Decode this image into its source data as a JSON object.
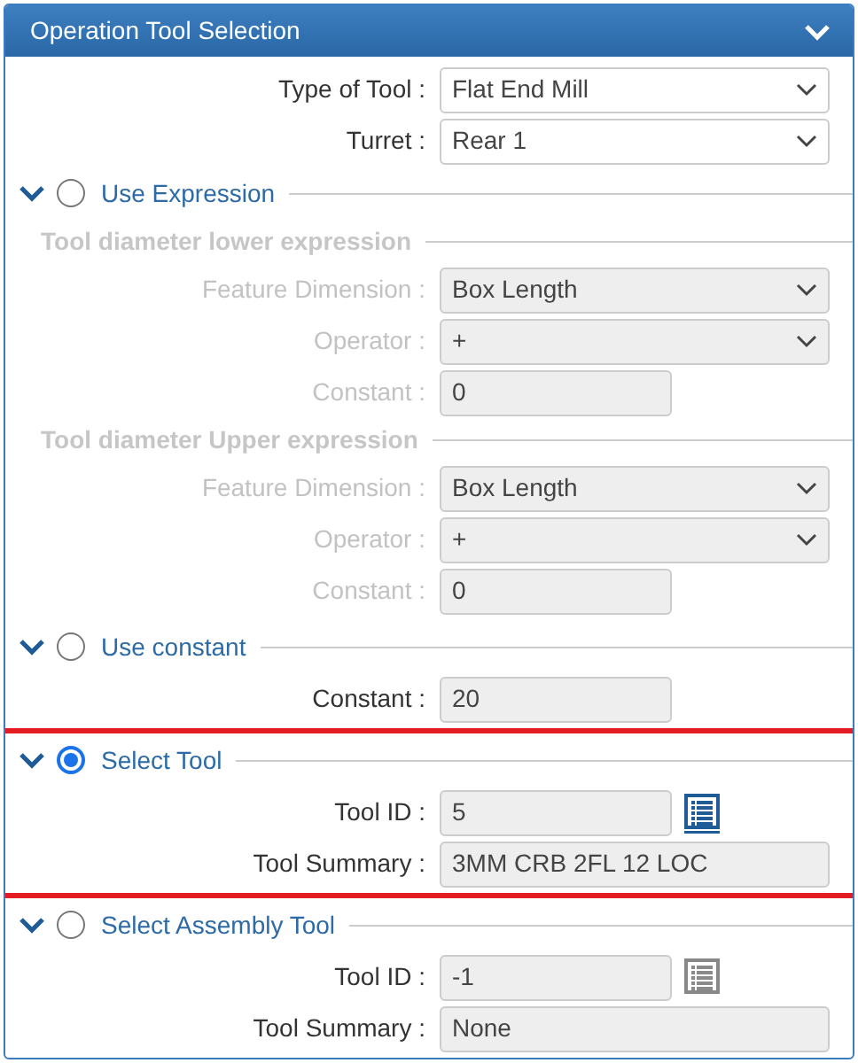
{
  "panel": {
    "title": "Operation Tool Selection",
    "expanded": true
  },
  "fields": [
    {
      "label": "Type of Tool :",
      "kind": "select",
      "value": "Flat End Mill",
      "disabled": false,
      "readonly": false
    },
    {
      "label": "Turret :",
      "kind": "select",
      "value": "Rear 1",
      "disabled": false,
      "readonly": false
    }
  ],
  "sections": [
    {
      "label": "Use Expression",
      "selected": false,
      "expanded": true,
      "highlighted": false,
      "groups": [
        {
          "heading": "Tool diameter lower expression",
          "fields": [
            {
              "label": "Feature Dimension :",
              "kind": "select",
              "value": "Box Length",
              "disabled": true
            },
            {
              "label": "Operator :",
              "kind": "select",
              "value": "+",
              "disabled": true
            },
            {
              "label": "Constant :",
              "kind": "text",
              "value": "0",
              "disabled": true
            }
          ]
        },
        {
          "heading": "Tool diameter Upper expression",
          "fields": [
            {
              "label": "Feature Dimension :",
              "kind": "select",
              "value": "Box Length",
              "disabled": true
            },
            {
              "label": "Operator :",
              "kind": "select",
              "value": "+",
              "disabled": true
            },
            {
              "label": "Constant :",
              "kind": "text",
              "value": "0",
              "disabled": true
            }
          ]
        }
      ]
    },
    {
      "label": "Use constant",
      "selected": false,
      "expanded": true,
      "highlighted": false,
      "groups": [
        {
          "fields": [
            {
              "label": "Constant :",
              "kind": "text",
              "value": "20",
              "disabled": false,
              "readonly": true
            }
          ]
        }
      ]
    },
    {
      "label": "Select Tool",
      "selected": true,
      "expanded": true,
      "highlighted": true,
      "groups": [
        {
          "fields": [
            {
              "label": "Tool ID :",
              "kind": "text",
              "value": "5",
              "disabled": false,
              "readonly": true,
              "picker": {
                "enabled": true
              }
            },
            {
              "label": "Tool Summary :",
              "kind": "wide",
              "value": "3MM CRB 2FL 12 LOC",
              "disabled": false,
              "readonly": true
            }
          ]
        }
      ]
    },
    {
      "label": "Select Assembly Tool",
      "selected": false,
      "expanded": true,
      "highlighted": false,
      "groups": [
        {
          "fields": [
            {
              "label": "Tool ID :",
              "kind": "text",
              "value": "-1",
              "disabled": false,
              "readonly": true,
              "picker": {
                "enabled": false
              }
            },
            {
              "label": "Tool Summary :",
              "kind": "wide",
              "value": "None",
              "disabled": false,
              "readonly": true
            }
          ]
        }
      ]
    }
  ]
}
